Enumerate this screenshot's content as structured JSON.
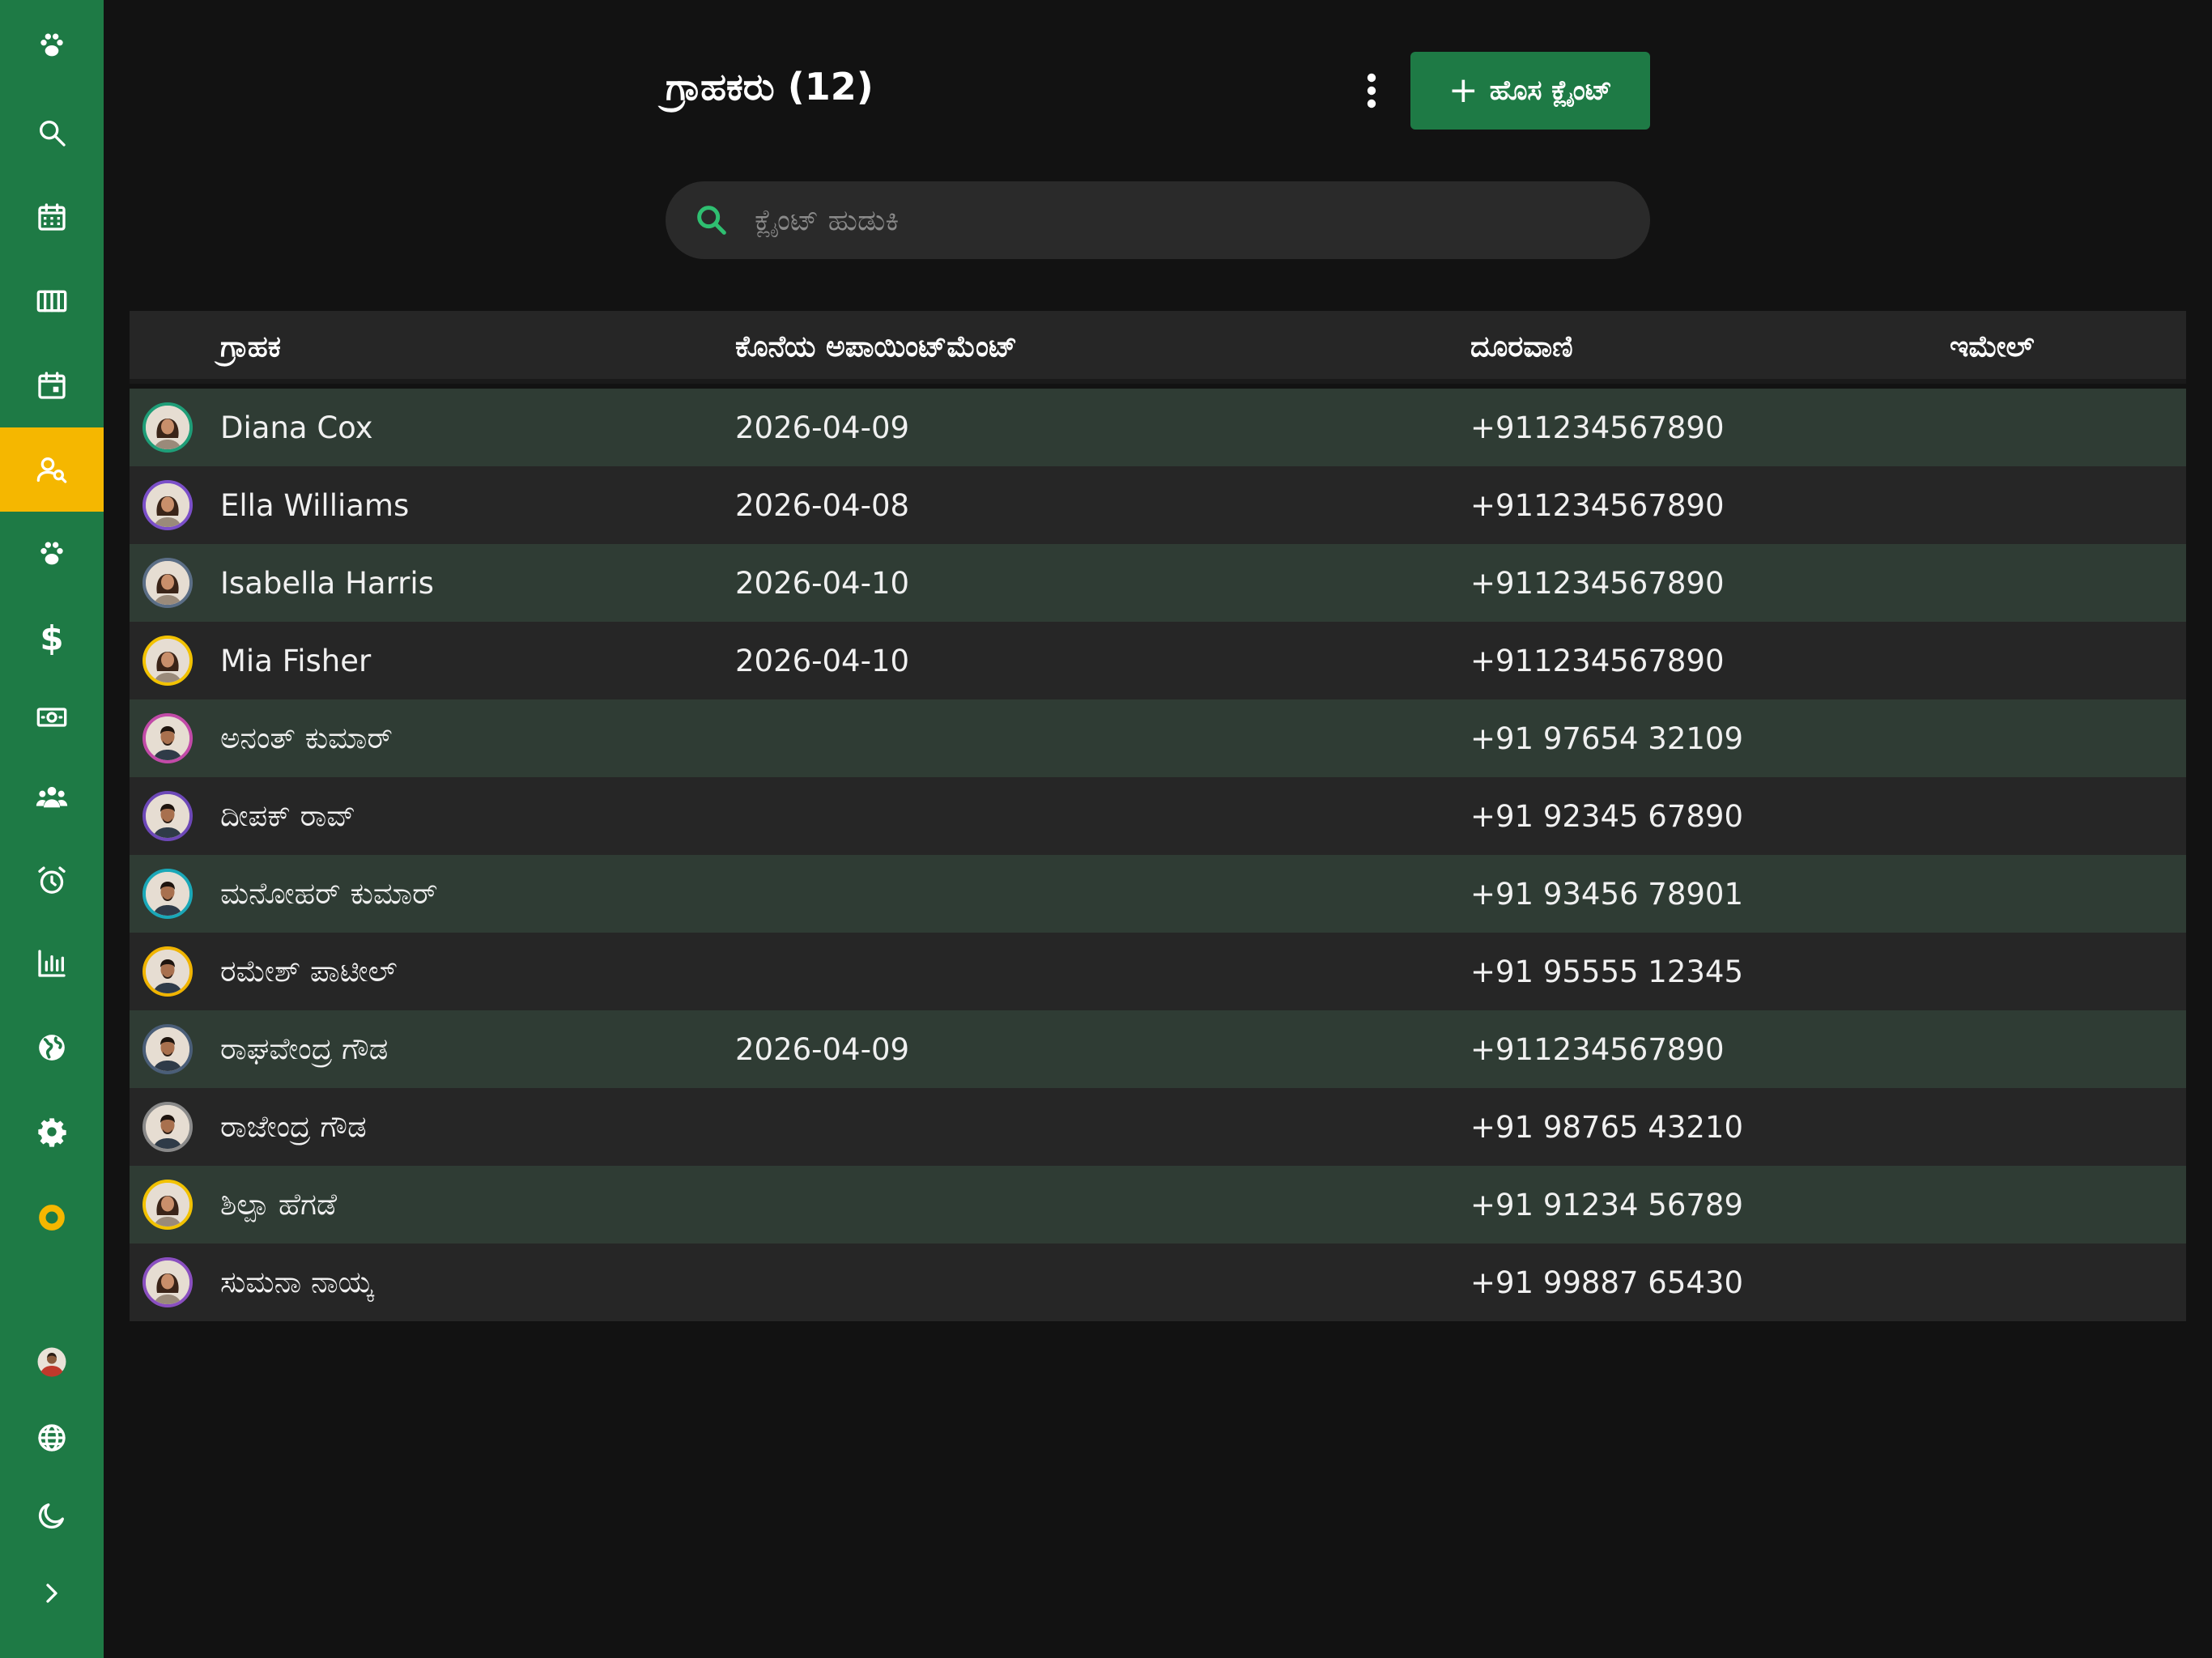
{
  "page": {
    "title": "ಗ್ರಾಹಕರು (12)",
    "new_client_label": "ಹೊಸ ಕ್ಲೈಂಟ್",
    "search_placeholder": "ಕ್ಲೈಂಟ್ ಹುಡುಕಿ"
  },
  "sidebar": {
    "items": [
      {
        "icon": "paw-icon"
      },
      {
        "icon": "search-icon"
      },
      {
        "icon": "calendar-icon"
      },
      {
        "icon": "columns-icon"
      },
      {
        "icon": "calendar-day-icon"
      },
      {
        "icon": "user-search-icon",
        "active": true
      },
      {
        "icon": "paw-icon"
      },
      {
        "icon": "dollar-icon",
        "glyph": "$"
      },
      {
        "icon": "banknote-icon"
      },
      {
        "icon": "users-icon"
      },
      {
        "icon": "alarm-icon"
      },
      {
        "icon": "bar-chart-icon"
      },
      {
        "icon": "globe-icon"
      },
      {
        "icon": "gear-icon"
      },
      {
        "icon": "ring-icon"
      }
    ],
    "bottom": [
      {
        "icon": "user-avatar-icon"
      },
      {
        "icon": "language-globe-icon"
      },
      {
        "icon": "moon-icon"
      },
      {
        "icon": "chevron-right-icon"
      }
    ]
  },
  "table": {
    "headers": {
      "client": "ಗ್ರಾಹಕ",
      "last_appointment": "ಕೊನೆಯ ಅಪಾಯಿಂಟ್‌ಮೆಂಟ್",
      "phone": "ದೂರವಾಣಿ",
      "email": "ಇಮೇಲ್"
    },
    "rows": [
      {
        "name": "Diana Cox",
        "last": "2026-04-09",
        "phone": "+911234567890",
        "email": "",
        "ring": "#1f9e78",
        "gender": "f"
      },
      {
        "name": "Ella Williams",
        "last": "2026-04-08",
        "phone": "+911234567890",
        "email": "",
        "ring": "#7b4fc9",
        "gender": "f"
      },
      {
        "name": "Isabella Harris",
        "last": "2026-04-10",
        "phone": "+911234567890",
        "email": "",
        "ring": "#5b6e86",
        "gender": "f"
      },
      {
        "name": "Mia Fisher",
        "last": "2026-04-10",
        "phone": "+911234567890",
        "email": "",
        "ring": "#f2c200",
        "gender": "f"
      },
      {
        "name": "ಅನಂತ್ ಕುಮಾರ್",
        "last": "",
        "phone": "+91 97654 32109",
        "email": "",
        "ring": "#c24aa8",
        "gender": "m"
      },
      {
        "name": "ದೀಪಕ್ ರಾವ್",
        "last": "",
        "phone": "+91 92345 67890",
        "email": "",
        "ring": "#6d48b8",
        "gender": "m"
      },
      {
        "name": "ಮನೋಹರ್ ಕುಮಾರ್",
        "last": "",
        "phone": "+91 93456 78901",
        "email": "",
        "ring": "#1aa8b8",
        "gender": "m"
      },
      {
        "name": "ರಮೇಶ್ ಪಾಟೀಲ್",
        "last": "",
        "phone": "+91 95555 12345",
        "email": "",
        "ring": "#f0b400",
        "gender": "m"
      },
      {
        "name": "ರಾಘವೇಂದ್ರ ಗೌಡ",
        "last": "2026-04-09",
        "phone": "+911234567890",
        "email": "",
        "ring": "#4a5e78",
        "gender": "m"
      },
      {
        "name": "ರಾಜೇಂದ್ರ ಗೌಡ",
        "last": "",
        "phone": "+91 98765 43210",
        "email": "",
        "ring": "#8a8a8a",
        "gender": "m"
      },
      {
        "name": "ಶಿಲ್ಪಾ ಹೆಗಡೆ",
        "last": "",
        "phone": "+91 91234 56789",
        "email": "",
        "ring": "#f2c200",
        "gender": "f"
      },
      {
        "name": "ಸುಮನಾ ನಾಯ್ಕ",
        "last": "",
        "phone": "+91 99887 65430",
        "email": "",
        "ring": "#8a4fc0",
        "gender": "f"
      }
    ]
  },
  "colors": {
    "sidebar": "#1e7a45",
    "active": "#f5b700",
    "accent_green": "#1e7a45",
    "search_icon": "#2fbf71"
  }
}
